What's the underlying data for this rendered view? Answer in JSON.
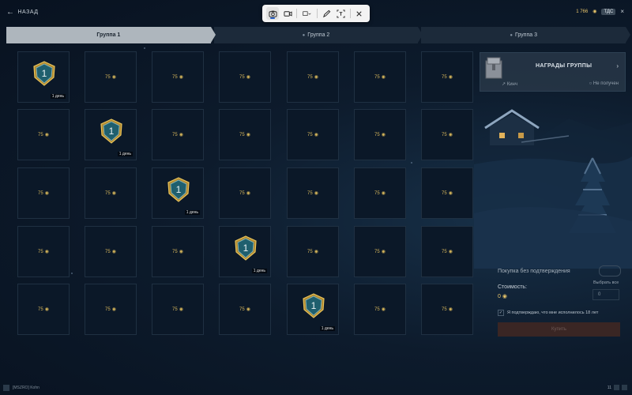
{
  "header": {
    "back_label": "НАЗАД",
    "currency_amount": "1 766",
    "badge": "ТДС"
  },
  "tabs": [
    {
      "label": "Группа 1",
      "active": true
    },
    {
      "label": "Группа 2",
      "active": false
    },
    {
      "label": "Группа 3",
      "active": false
    }
  ],
  "grid": {
    "price_label": "75",
    "days_label": "1 день",
    "medal_number": "1",
    "rows": [
      [
        "medal",
        "price",
        "price",
        "price",
        "price",
        "price",
        "price"
      ],
      [
        "price",
        "medal",
        "price",
        "price",
        "price",
        "price",
        "price"
      ],
      [
        "price",
        "price",
        "medal",
        "price",
        "price",
        "price",
        "price"
      ],
      [
        "price",
        "price",
        "price",
        "medal",
        "price",
        "price",
        "price"
      ],
      [
        "price",
        "price",
        "price",
        "price",
        "medal",
        "price",
        "price"
      ]
    ]
  },
  "rewards_panel": {
    "title": "НАГРАДЫ ГРУППЫ",
    "left_sub": "Кинч",
    "right_sub": "Не получен"
  },
  "purchase": {
    "no_confirm_label": "Покупка без подтверждения",
    "cost_label": "Стоимость:",
    "cost_value": "0",
    "select_all": "Выбрать все",
    "qty_value": "0",
    "confirm_text": "Я подтверждаю, что мне исполнилось 18 лет",
    "buy_button": "Купить"
  },
  "footer": {
    "left_text": "[MSZRO] Kohn",
    "right_text": "11"
  },
  "colors": {
    "gold": "#e8c56a",
    "tab_active": "#aeb6bd",
    "background": "#0d1b2c"
  }
}
